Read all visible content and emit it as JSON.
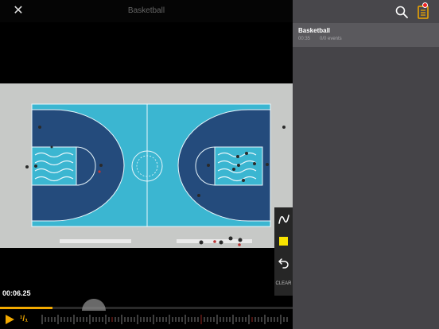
{
  "header": {
    "title": "Basketball"
  },
  "player": {
    "timecode": "00:06.25",
    "speed": "¹/₁",
    "progress_fraction": 0.18
  },
  "tools": {
    "clear_label": "CLEAR",
    "color": "#f8e300"
  },
  "sidebar": {
    "sessions": [
      {
        "title": "Basketball",
        "duration": "00:35",
        "events": "0/0 events"
      }
    ],
    "badge_color": "#e22222"
  },
  "colors": {
    "accent": "#f2a900",
    "court": "#3bb4d0",
    "key": "#244b7c"
  }
}
